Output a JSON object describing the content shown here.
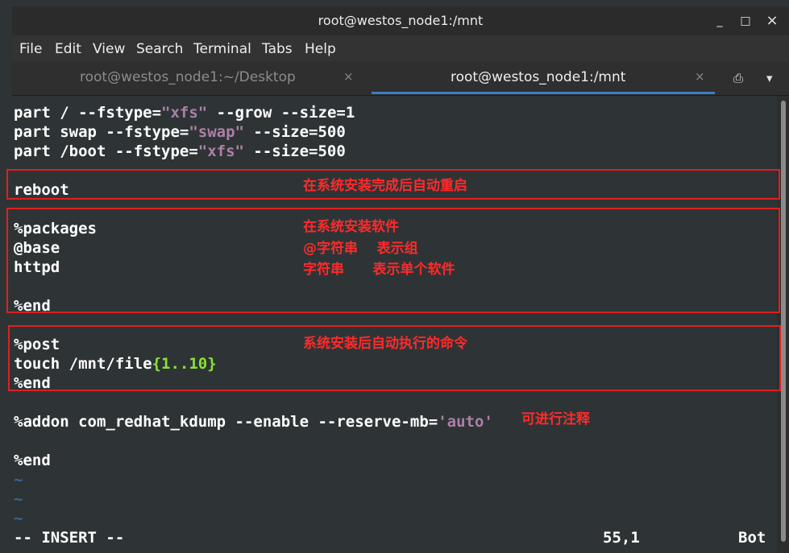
{
  "window": {
    "title": "root@westos_node1:/mnt",
    "controls": {
      "minimize": "_",
      "maximize": "□",
      "close": "×"
    }
  },
  "menu": [
    "File",
    "Edit",
    "View",
    "Search",
    "Terminal",
    "Tabs",
    "Help"
  ],
  "tabs": [
    {
      "label": "root@westos_node1:~/Desktop",
      "close": "×",
      "active": false
    },
    {
      "label": "root@westos_node1:/mnt",
      "close": "×",
      "active": true
    }
  ],
  "tab_tools": {
    "new_tab": "⎙",
    "menu": "▾"
  },
  "editor": {
    "lines": {
      "l1_a": "part / --fstype=",
      "l1_str": "\"xfs\"",
      "l1_b": " --grow --size=1",
      "l2_a": "part swap --fstype=",
      "l2_str": "\"swap\"",
      "l2_b": " --size=500",
      "l3_a": "part /boot --fstype=",
      "l3_str": "\"xfs\"",
      "l3_b": " --size=500",
      "l5": "reboot",
      "l7": "%packages",
      "l8": "@base",
      "l9": "httpd",
      "l11": "%end",
      "l13": "%post",
      "l14_a": "touch /mnt/file",
      "l14_brace": "{1..10}",
      "l15": "%end",
      "l17_a": "%addon com_redhat_kdump --enable --reserve-mb=",
      "l17_str": "'auto'",
      "l19": "%end",
      "tilde": "~"
    },
    "status": {
      "mode": "-- INSERT --",
      "position": "55,1",
      "scroll": "Bot"
    }
  },
  "annotations": {
    "reboot": "在系统安装完成后自动重启",
    "packages_1": "在系统安装软件",
    "packages_2": "@字符串    表示组",
    "packages_3": "字符串      表示单个软件",
    "post": "系统安装后自动执行的命令",
    "addon": "可进行注释"
  },
  "colors": {
    "background": "#2e3436",
    "string": "#ad7fa8",
    "brace": "#8ae234",
    "tilde": "#3465a4",
    "annotation": "#ff2a2a"
  }
}
